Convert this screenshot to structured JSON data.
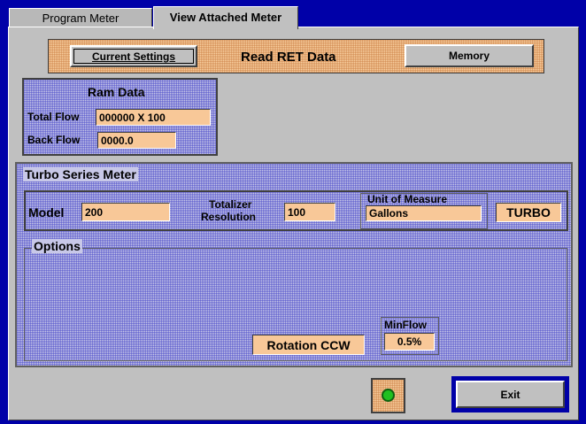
{
  "tabs": [
    "Program Meter",
    "View Attached Meter"
  ],
  "toolbar": {
    "current_settings": "Current Settings",
    "read_ret": "Read RET Data",
    "memory": "Memory"
  },
  "ram": {
    "title": "Ram Data",
    "total_flow_label": "Total Flow",
    "total_flow_value": "000000 X 100",
    "back_flow_label": "Back Flow",
    "back_flow_value": "0000.0"
  },
  "meter": {
    "title": "Turbo Series Meter",
    "model_label": "Model",
    "model_value": "200",
    "totalizer_label_1": "Totalizer",
    "totalizer_label_2": "Resolution",
    "totalizer_value": "100",
    "uom_label": "Unit of Measure",
    "uom_value": "Gallons",
    "type_value": "TURBO"
  },
  "options": {
    "title": "Options",
    "rotation": "Rotation CCW",
    "minflow_label": "MinFlow",
    "minflow_value": "0.5%"
  },
  "footer": {
    "exit": "Exit"
  },
  "colors": {
    "background": "#0000a8",
    "panel": "#c0c0c0",
    "field": "#f8c898",
    "status_led": "#20c020"
  }
}
